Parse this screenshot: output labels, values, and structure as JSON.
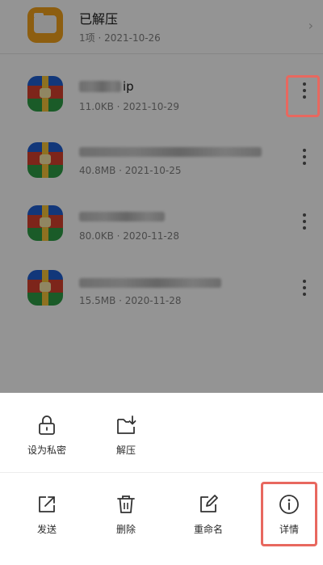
{
  "folder": {
    "name": "已解压",
    "meta": "1项 · 2021-10-26",
    "icon": "folder-icon",
    "chevron": "chevron-right-icon"
  },
  "files": [
    {
      "name_visible": "下载(…).zip",
      "name_suffix": "ip",
      "meta": "11.0KB · 2021-10-29",
      "icon": "zip-archive-icon"
    },
    {
      "name_visible": "",
      "meta": "40.8MB · 2021-10-25",
      "icon": "zip-archive-icon"
    },
    {
      "name_visible": "",
      "meta": "80.0KB · 2020-11-28",
      "icon": "zip-archive-icon"
    },
    {
      "name_visible": "",
      "meta": "15.5MB · 2020-11-28",
      "icon": "zip-archive-icon"
    }
  ],
  "sheet": {
    "row1": [
      {
        "label": "设为私密",
        "icon": "lock-icon"
      },
      {
        "label": "解压",
        "icon": "extract-icon"
      }
    ],
    "row2": [
      {
        "label": "发送",
        "icon": "share-icon"
      },
      {
        "label": "删除",
        "icon": "trash-icon"
      },
      {
        "label": "重命名",
        "icon": "rename-icon"
      },
      {
        "label": "详情",
        "icon": "info-icon"
      }
    ]
  },
  "colors": {
    "highlight": "#e8685f",
    "folder": "#f3a21d",
    "overlay": "rgba(0,0,0,0.42)"
  }
}
